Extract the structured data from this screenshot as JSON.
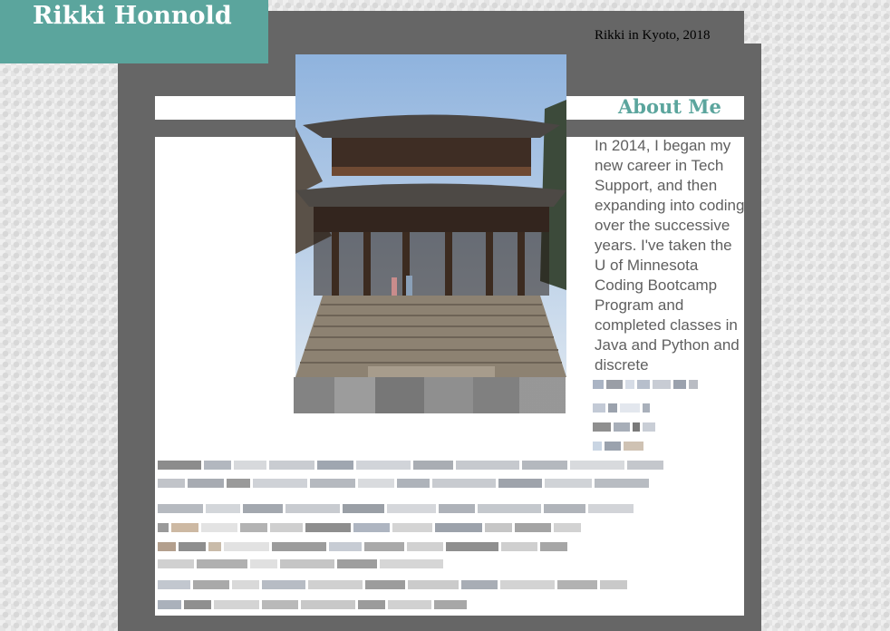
{
  "header": {
    "site_title": "Rikki Honnold",
    "photo_caption": "Rikki in Kyoto, 2018"
  },
  "about": {
    "heading": "About Me",
    "paragraph": "In 2014, I began my new career in Tech Support, and then expanding into coding over the successive years. I've taken the U of Minnesota Coding Bootcamp Program and completed classes in Java and Python and discrete"
  },
  "colors": {
    "accent": "#5ba59d",
    "panel_gray": "#666666",
    "body_text": "#5f5f5f"
  },
  "photo": {
    "subject": "temple-gate-photo"
  }
}
